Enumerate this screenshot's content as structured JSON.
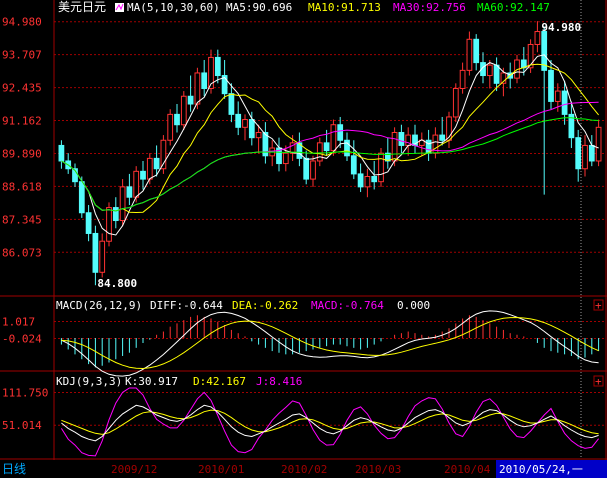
{
  "header": {
    "symbol": "美元日元",
    "ma_label": "MA(5,10,30,60)",
    "ma5": "MA5:90.696",
    "ma10": "MA10:91.713",
    "ma30": "MA30:92.756",
    "ma60": "MA60:92.147"
  },
  "macd_header": {
    "name": "MACD(26,12,9)",
    "diff": "DIFF:-0.644",
    "dea": "DEA:-0.262",
    "macd": "MACD:-0.764",
    "extra": "0.000"
  },
  "kdj_header": {
    "name": "KDJ(9,3,3)",
    "k": "K:30.917",
    "d": "D:42.167",
    "j": "J:8.416"
  },
  "bottom": {
    "period_tab": "日线",
    "dates": [
      "2009/12",
      "2010/01",
      "2010/02",
      "2010/03",
      "2010/04"
    ],
    "cursor_date": "2010/05/24,一"
  },
  "colors": {
    "up": "#ff3232",
    "down": "#54fcfc",
    "ma5": "#ffffff",
    "ma10": "#ffff00",
    "ma30": "#ff00ff",
    "ma60": "#00ff00",
    "grid": "#a00000",
    "axis": "#a00000"
  },
  "chart_data": [
    {
      "type": "candlestick",
      "title": "美元日元",
      "ylim": [
        84.5,
        95.2
      ],
      "y_ticks": [
        "94.980",
        "93.707",
        "92.435",
        "91.162",
        "89.890",
        "88.618",
        "87.345",
        "86.073"
      ],
      "annotations": {
        "high": "94.980",
        "low": "84.800"
      },
      "series": [
        {
          "name": "MA5",
          "last": 90.696
        },
        {
          "name": "MA10",
          "last": 91.713
        },
        {
          "name": "MA30",
          "last": 92.756
        },
        {
          "name": "MA60",
          "last": 92.147
        }
      ],
      "candles": [
        [
          90.2,
          90.4,
          89.3,
          89.6
        ],
        [
          89.6,
          89.9,
          89.1,
          89.3
        ],
        [
          89.3,
          89.5,
          88.6,
          88.8
        ],
        [
          88.8,
          89.0,
          87.4,
          87.6
        ],
        [
          87.6,
          87.9,
          86.5,
          86.8
        ],
        [
          86.8,
          87.1,
          84.8,
          85.3
        ],
        [
          85.3,
          86.8,
          85.1,
          86.5
        ],
        [
          86.5,
          88.0,
          86.3,
          87.8
        ],
        [
          87.8,
          88.2,
          87.0,
          87.3
        ],
        [
          87.3,
          88.9,
          87.1,
          88.6
        ],
        [
          88.6,
          89.1,
          87.9,
          88.2
        ],
        [
          88.2,
          89.4,
          88.0,
          89.2
        ],
        [
          89.2,
          89.6,
          88.5,
          88.9
        ],
        [
          88.9,
          89.9,
          88.7,
          89.7
        ],
        [
          89.7,
          90.2,
          89.0,
          89.3
        ],
        [
          89.3,
          90.6,
          89.1,
          90.4
        ],
        [
          90.4,
          91.6,
          90.2,
          91.4
        ],
        [
          91.4,
          91.8,
          90.7,
          91.0
        ],
        [
          91.0,
          92.3,
          90.8,
          92.1
        ],
        [
          92.1,
          92.9,
          91.5,
          91.8
        ],
        [
          91.8,
          93.2,
          91.6,
          93.0
        ],
        [
          93.0,
          93.5,
          92.1,
          92.4
        ],
        [
          92.4,
          93.9,
          92.2,
          93.6
        ],
        [
          93.6,
          93.9,
          92.6,
          92.9
        ],
        [
          92.9,
          93.5,
          92.0,
          92.2
        ],
        [
          92.2,
          92.6,
          91.1,
          91.4
        ],
        [
          91.4,
          91.9,
          90.6,
          90.9
        ],
        [
          90.9,
          91.4,
          90.4,
          91.2
        ],
        [
          91.2,
          91.5,
          90.2,
          90.5
        ],
        [
          90.5,
          91.0,
          89.9,
          90.7
        ],
        [
          90.7,
          91.1,
          89.5,
          89.8
        ],
        [
          89.8,
          90.4,
          89.4,
          90.1
        ],
        [
          90.1,
          90.5,
          89.2,
          89.5
        ],
        [
          89.5,
          90.2,
          89.2,
          89.9
        ],
        [
          89.9,
          90.6,
          89.6,
          90.3
        ],
        [
          90.3,
          90.7,
          89.4,
          89.7
        ],
        [
          89.7,
          90.0,
          88.7,
          88.9
        ],
        [
          88.9,
          89.8,
          88.6,
          89.6
        ],
        [
          89.6,
          90.5,
          89.4,
          90.3
        ],
        [
          90.3,
          90.8,
          89.8,
          90.0
        ],
        [
          90.0,
          91.2,
          89.8,
          91.0
        ],
        [
          91.0,
          91.3,
          90.1,
          90.4
        ],
        [
          90.4,
          90.7,
          89.6,
          89.8
        ],
        [
          89.8,
          90.4,
          88.9,
          89.1
        ],
        [
          89.1,
          89.5,
          88.4,
          88.6
        ],
        [
          88.6,
          89.3,
          88.2,
          89.0
        ],
        [
          89.0,
          89.6,
          88.5,
          88.8
        ],
        [
          88.8,
          90.1,
          88.6,
          89.9
        ],
        [
          89.9,
          90.5,
          89.3,
          89.6
        ],
        [
          89.6,
          90.9,
          89.4,
          90.7
        ],
        [
          90.7,
          91.0,
          89.9,
          90.2
        ],
        [
          90.2,
          90.9,
          89.8,
          90.6
        ],
        [
          90.6,
          91.0,
          89.9,
          90.2
        ],
        [
          90.2,
          90.7,
          89.8,
          90.4
        ],
        [
          90.4,
          90.8,
          89.6,
          89.9
        ],
        [
          89.9,
          90.9,
          89.7,
          90.6
        ],
        [
          90.6,
          91.3,
          90.2,
          90.4
        ],
        [
          90.4,
          91.5,
          90.1,
          91.3
        ],
        [
          91.3,
          92.6,
          91.1,
          92.4
        ],
        [
          92.4,
          93.4,
          92.2,
          93.1
        ],
        [
          93.1,
          94.6,
          92.9,
          94.3
        ],
        [
          94.3,
          94.5,
          93.1,
          93.4
        ],
        [
          93.4,
          93.8,
          92.6,
          92.9
        ],
        [
          92.9,
          93.5,
          92.4,
          93.3
        ],
        [
          93.3,
          93.6,
          92.3,
          92.6
        ],
        [
          92.6,
          93.2,
          92.1,
          93.0
        ],
        [
          93.0,
          93.4,
          92.4,
          92.8
        ],
        [
          92.8,
          93.7,
          92.6,
          93.5
        ],
        [
          93.5,
          94.0,
          92.9,
          93.2
        ],
        [
          93.2,
          94.3,
          93.0,
          94.1
        ],
        [
          94.1,
          95.0,
          93.8,
          94.6
        ],
        [
          94.6,
          94.8,
          88.3,
          93.1
        ],
        [
          93.1,
          93.5,
          91.6,
          91.9
        ],
        [
          91.9,
          92.6,
          91.5,
          92.3
        ],
        [
          92.3,
          92.7,
          91.0,
          91.4
        ],
        [
          91.4,
          91.9,
          90.1,
          90.5
        ],
        [
          90.5,
          90.8,
          88.8,
          89.3
        ],
        [
          89.3,
          90.6,
          89.0,
          90.2
        ],
        [
          90.2,
          90.6,
          89.4,
          89.6
        ],
        [
          89.6,
          91.2,
          89.4,
          90.9
        ]
      ]
    },
    {
      "type": "bar",
      "title": "MACD(26,12,9)",
      "ylim": [
        -1.9,
        1.6
      ],
      "y_ticks": [
        "1.017",
        "-0.024"
      ],
      "series": [
        {
          "name": "DIFF",
          "last": -0.644
        },
        {
          "name": "DEA",
          "last": -0.262
        },
        {
          "name": "MACD",
          "last": -0.764
        }
      ],
      "macd_bars": [
        -0.4,
        -0.7,
        -1.0,
        -1.3,
        -1.6,
        -1.8,
        -1.7,
        -1.5,
        -1.3,
        -1.1,
        -0.9,
        -0.6,
        -0.3,
        -0.1,
        0.2,
        0.4,
        0.7,
        0.9,
        1.1,
        1.3,
        1.4,
        1.3,
        1.2,
        1.0,
        0.8,
        0.5,
        0.3,
        0.1,
        -0.2,
        -0.4,
        -0.6,
        -0.8,
        -0.9,
        -1.0,
        -1.0,
        -0.9,
        -0.8,
        -0.7,
        -0.6,
        -0.5,
        -0.4,
        -0.4,
        -0.5,
        -0.6,
        -0.7,
        -0.6,
        -0.4,
        -0.2,
        0.0,
        0.2,
        0.3,
        0.4,
        0.3,
        0.2,
        0.1,
        0.2,
        0.4,
        0.6,
        0.9,
        1.2,
        1.4,
        1.3,
        1.1,
        0.9,
        0.7,
        0.5,
        0.3,
        0.2,
        0.1,
        0.0,
        -0.3,
        -0.6,
        -0.8,
        -0.9,
        -1.0,
        -1.1,
        -1.3,
        -1.2,
        -1.0,
        -0.8
      ]
    },
    {
      "type": "line",
      "title": "KDJ(9,3,3)",
      "ylim": [
        -8,
        120
      ],
      "y_ticks": [
        "111.750",
        "51.014"
      ],
      "series": [
        {
          "name": "K",
          "last": 30.917
        },
        {
          "name": "D",
          "last": 42.167
        },
        {
          "name": "J",
          "last": 8.416
        }
      ],
      "k": [
        55,
        45,
        38,
        30,
        25,
        22,
        30,
        45,
        60,
        72,
        80,
        88,
        85,
        78,
        70,
        65,
        60,
        58,
        62,
        70,
        80,
        88,
        85,
        75,
        62,
        48,
        38,
        32,
        30,
        35,
        40,
        48,
        55,
        62,
        70,
        72,
        65,
        55,
        45,
        38,
        35,
        40,
        50,
        60,
        65,
        62,
        55,
        48,
        42,
        40,
        45,
        55,
        65,
        72,
        78,
        80,
        75,
        65,
        55,
        50,
        55,
        65,
        75,
        80,
        78,
        70,
        60,
        52,
        48,
        50,
        55,
        62,
        68,
        60,
        50,
        42,
        35,
        30,
        28,
        32
      ],
      "d": [
        60,
        55,
        50,
        45,
        40,
        36,
        34,
        37,
        44,
        52,
        60,
        68,
        74,
        76,
        74,
        71,
        67,
        64,
        63,
        65,
        70,
        76,
        79,
        78,
        73,
        65,
        56,
        48,
        42,
        39,
        39,
        42,
        46,
        51,
        57,
        62,
        63,
        61,
        56,
        50,
        45,
        43,
        45,
        50,
        55,
        57,
        57,
        54,
        50,
        46,
        46,
        49,
        54,
        60,
        66,
        70,
        72,
        70,
        65,
        60,
        58,
        60,
        65,
        70,
        73,
        72,
        68,
        63,
        58,
        55,
        55,
        58,
        61,
        61,
        57,
        52,
        46,
        41,
        37,
        35
      ],
      "j": [
        45,
        25,
        14,
        0,
        -5,
        -6,
        22,
        61,
        92,
        112,
        120,
        120,
        107,
        82,
        62,
        53,
        46,
        46,
        60,
        80,
        100,
        112,
        97,
        69,
        40,
        14,
        2,
        0,
        6,
        27,
        42,
        60,
        73,
        84,
        96,
        92,
        69,
        43,
        23,
        14,
        15,
        34,
        60,
        80,
        85,
        72,
        51,
        36,
        26,
        28,
        43,
        67,
        87,
        96,
        102,
        100,
        81,
        55,
        35,
        30,
        49,
        75,
        95,
        100,
        88,
        66,
        44,
        30,
        28,
        40,
        55,
        70,
        82,
        58,
        36,
        22,
        13,
        8,
        10,
        26
      ]
    }
  ]
}
